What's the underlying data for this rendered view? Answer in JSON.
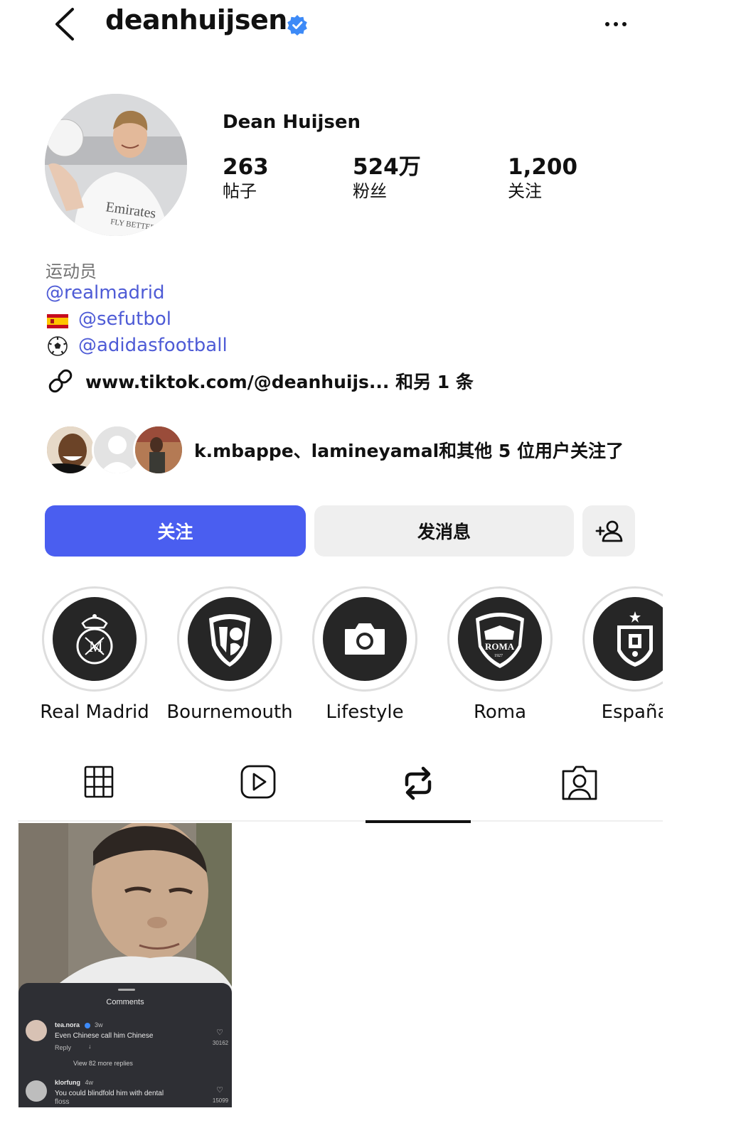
{
  "header": {
    "username": "deanhuijsen",
    "back_icon": "chevron-left-icon",
    "verified_icon": "verified-badge-icon",
    "more_icon": "more-horizontal-icon"
  },
  "profile": {
    "full_name": "Dean Huijsen",
    "stats": [
      {
        "value": "263",
        "label": "帖子"
      },
      {
        "value": "524万",
        "label": "粉丝"
      },
      {
        "value": "1,200",
        "label": "关注"
      }
    ],
    "category": "运动员",
    "bio_links": [
      {
        "emoji": "",
        "text": "@realmadrid"
      },
      {
        "emoji": "spain-flag",
        "text": "@sefutbol"
      },
      {
        "emoji": "soccer-ball",
        "text": "@adidasfootball"
      }
    ],
    "external_link": "www.tiktok.com/@deanhuijs... 和另 1 条",
    "mutual_followers": "k.mbappe、lamineyamal和其他 5 位用户关注了"
  },
  "actions": {
    "follow_label": "关注",
    "message_label": "发消息",
    "add_user_icon": "add-person-icon"
  },
  "highlights": [
    {
      "label": "Real Madrid",
      "icon": "real-madrid-crest-icon"
    },
    {
      "label": "Bournemouth",
      "icon": "bournemouth-crest-icon"
    },
    {
      "label": "Lifestyle",
      "icon": "camera-icon"
    },
    {
      "label": "Roma",
      "icon": "roma-crest-icon"
    },
    {
      "label": "España",
      "icon": "spain-crest-icon"
    }
  ],
  "tabs": [
    {
      "icon": "grid-icon",
      "active": false
    },
    {
      "icon": "reels-icon",
      "active": false
    },
    {
      "icon": "reposts-icon",
      "active": true
    },
    {
      "icon": "tagged-icon",
      "active": false
    }
  ],
  "post": {
    "comments_title": "Comments",
    "comment1_user": "tea.nora",
    "comment1_time": "3w",
    "comment1_text": "Even Chinese call him Chinese",
    "comment1_reply": "Reply",
    "comment1_likes": "30162",
    "view_more": "View 82 more replies",
    "comment2_user": "klorfung",
    "comment2_time": "4w",
    "comment2_text": "You could blindfold him with dental",
    "comment2_text_more": "floss",
    "comment2_likes": "15099"
  },
  "colors": {
    "follow_button": "#4a5ef0",
    "link": "#4e5bd6",
    "verified": "#3d8af7",
    "secondary_button": "#efefef"
  }
}
